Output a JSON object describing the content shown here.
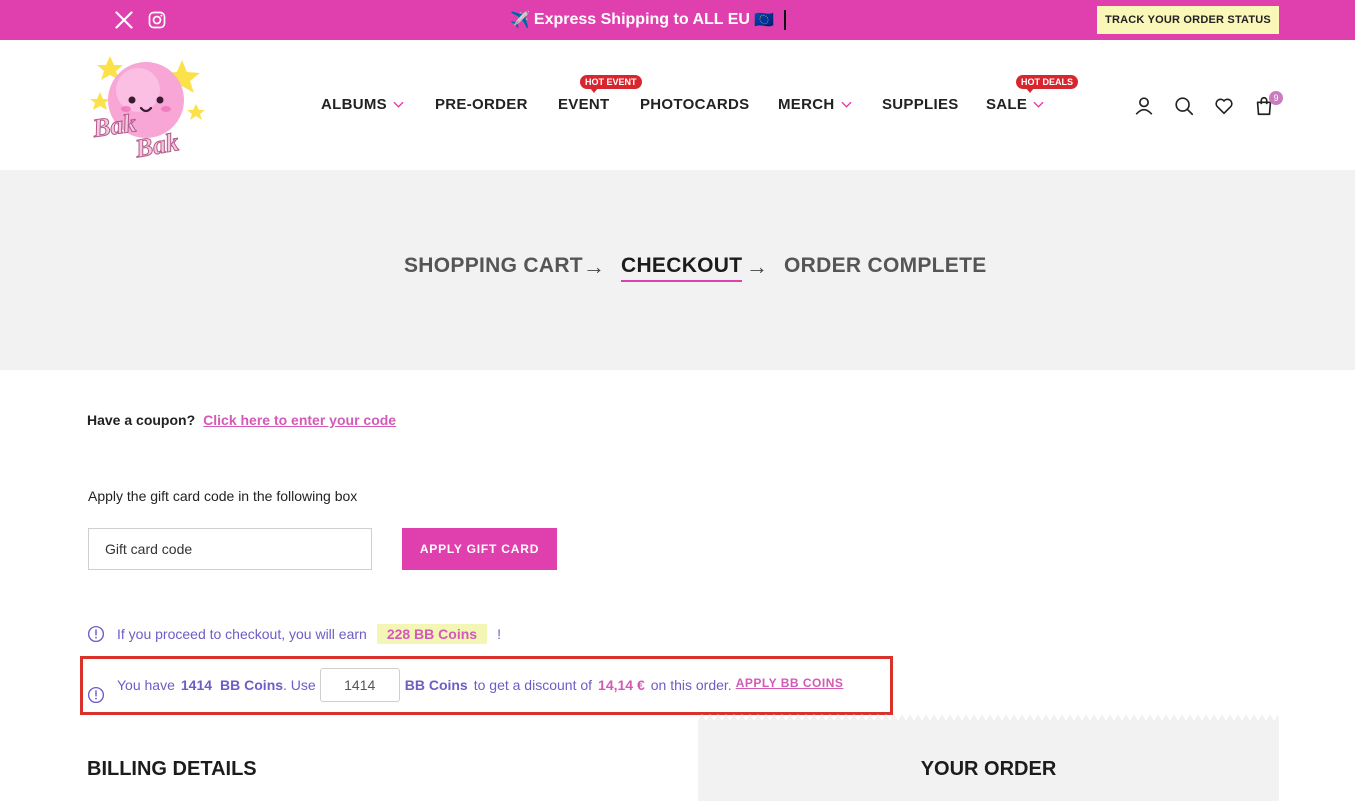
{
  "topbar": {
    "promo_icon": "✈️",
    "promo_text": "Express Shipping to ALL EU",
    "promo_flag": "🇪🇺",
    "track_button": "TRACK YOUR ORDER STATUS",
    "social": [
      "x-icon",
      "instagram-icon"
    ],
    "bg_color": "#e040ad"
  },
  "logo": {
    "text": "BakBak"
  },
  "nav": {
    "albums": "ALBUMS",
    "preorder": "PRE-ORDER",
    "event": "EVENT",
    "event_tag": "HOT EVENT",
    "photocards": "PHOTOCARDS",
    "merch": "MERCH",
    "supplies": "SUPPLIES",
    "sale": "SALE",
    "sale_tag": "HOT DEALS"
  },
  "header_icons": {
    "cart_count": "9"
  },
  "steps": {
    "cart": "SHOPPING CART",
    "checkout": "CHECKOUT",
    "complete": "ORDER COMPLETE",
    "arrow": "→"
  },
  "coupon": {
    "question": "Have a coupon?",
    "link": "Click here to enter your code"
  },
  "gift": {
    "label": "Apply the gift card code in the following box",
    "placeholder": "Gift card code",
    "button": "APPLY GIFT CARD"
  },
  "earn": {
    "text": "If you proceed to checkout, you will earn",
    "amount": "228 BB Coins",
    "suffix": "!"
  },
  "coins": {
    "you_have": "You have",
    "balance": "1414",
    "unit": "BB Coins",
    "use": ". Use",
    "input_value": "1414",
    "unit2": "BB Coins",
    "discount_text": "to get a discount of",
    "discount": "14,14 €",
    "order_text": "on this order.",
    "apply": "APPLY BB COINS"
  },
  "billing": {
    "title": "BILLING DETAILS"
  },
  "order": {
    "title": "YOUR ORDER"
  }
}
